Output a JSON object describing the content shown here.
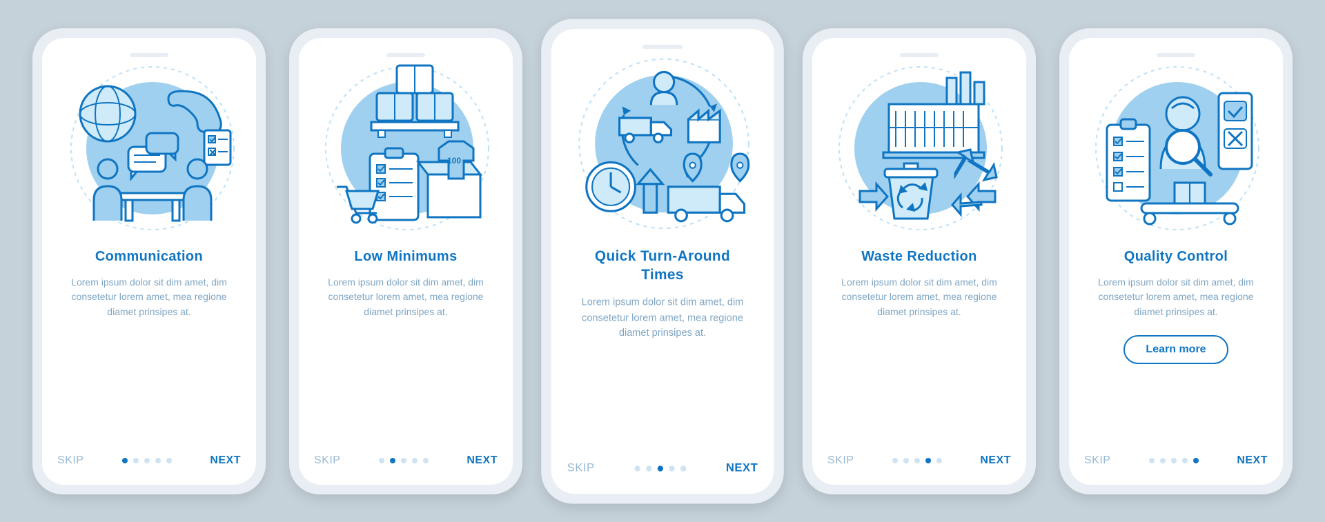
{
  "common": {
    "skip": "SKIP",
    "next": "NEXT",
    "body": "Lorem ipsum dolor sit dim amet, dim consetetur lorem amet, mea regione diamet prinsipes at."
  },
  "screens": [
    {
      "title": "Communication",
      "activeDot": 0,
      "cta": null
    },
    {
      "title": "Low Minimums",
      "activeDot": 1,
      "cta": null
    },
    {
      "title": "Quick Turn-Around Times",
      "activeDot": 2,
      "cta": null
    },
    {
      "title": "Waste Reduction",
      "activeDot": 3,
      "cta": null
    },
    {
      "title": "Quality Control",
      "activeDot": 4,
      "cta": "Learn more"
    }
  ],
  "colors": {
    "primary": "#0f75c2",
    "muted": "#7fa6c4",
    "bg": "#c6d2da"
  }
}
